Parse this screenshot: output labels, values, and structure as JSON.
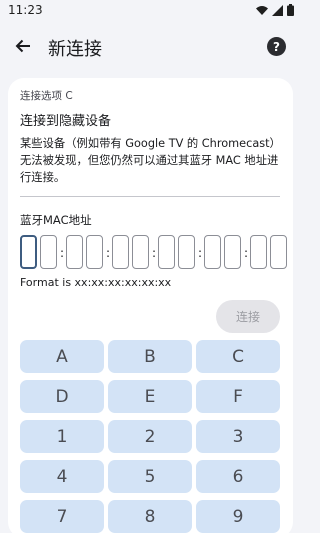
{
  "status_bar": {
    "time": "11:23"
  },
  "app_bar": {
    "title": "新连接",
    "help": "?"
  },
  "card": {
    "option_label": "连接选项 C",
    "title": "连接到隐藏设备",
    "description": "某些设备（例如带有 Google TV 的 Chromecast）无法被发现，但您仍然可以通过其蓝牙 MAC 地址进行连接。",
    "mac_label": "蓝牙MAC地址",
    "format_text": "Format is xx:xx:xx:xx:xx:xx",
    "connect_label": "连接",
    "mac_separator": ":"
  },
  "keypad": {
    "keys": [
      "A",
      "B",
      "C",
      "D",
      "E",
      "F",
      "1",
      "2",
      "3",
      "4",
      "5",
      "6",
      "7",
      "8",
      "9"
    ]
  },
  "colors": {
    "background": "#f3f4f8",
    "card": "#ffffff",
    "key": "#d3e3f6",
    "focus_border": "#3e5c80",
    "disabled_button": "#e4e4e8"
  }
}
